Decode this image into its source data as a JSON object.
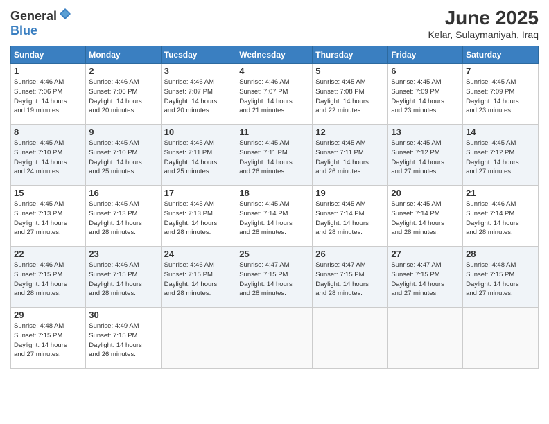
{
  "logo": {
    "general": "General",
    "blue": "Blue"
  },
  "header": {
    "title": "June 2025",
    "subtitle": "Kelar, Sulaymaniyah, Iraq"
  },
  "weekdays": [
    "Sunday",
    "Monday",
    "Tuesday",
    "Wednesday",
    "Thursday",
    "Friday",
    "Saturday"
  ],
  "weeks": [
    [
      {
        "day": "1",
        "info": "Sunrise: 4:46 AM\nSunset: 7:06 PM\nDaylight: 14 hours\nand 19 minutes."
      },
      {
        "day": "2",
        "info": "Sunrise: 4:46 AM\nSunset: 7:06 PM\nDaylight: 14 hours\nand 20 minutes."
      },
      {
        "day": "3",
        "info": "Sunrise: 4:46 AM\nSunset: 7:07 PM\nDaylight: 14 hours\nand 20 minutes."
      },
      {
        "day": "4",
        "info": "Sunrise: 4:46 AM\nSunset: 7:07 PM\nDaylight: 14 hours\nand 21 minutes."
      },
      {
        "day": "5",
        "info": "Sunrise: 4:45 AM\nSunset: 7:08 PM\nDaylight: 14 hours\nand 22 minutes."
      },
      {
        "day": "6",
        "info": "Sunrise: 4:45 AM\nSunset: 7:09 PM\nDaylight: 14 hours\nand 23 minutes."
      },
      {
        "day": "7",
        "info": "Sunrise: 4:45 AM\nSunset: 7:09 PM\nDaylight: 14 hours\nand 23 minutes."
      }
    ],
    [
      {
        "day": "8",
        "info": "Sunrise: 4:45 AM\nSunset: 7:10 PM\nDaylight: 14 hours\nand 24 minutes."
      },
      {
        "day": "9",
        "info": "Sunrise: 4:45 AM\nSunset: 7:10 PM\nDaylight: 14 hours\nand 25 minutes."
      },
      {
        "day": "10",
        "info": "Sunrise: 4:45 AM\nSunset: 7:11 PM\nDaylight: 14 hours\nand 25 minutes."
      },
      {
        "day": "11",
        "info": "Sunrise: 4:45 AM\nSunset: 7:11 PM\nDaylight: 14 hours\nand 26 minutes."
      },
      {
        "day": "12",
        "info": "Sunrise: 4:45 AM\nSunset: 7:11 PM\nDaylight: 14 hours\nand 26 minutes."
      },
      {
        "day": "13",
        "info": "Sunrise: 4:45 AM\nSunset: 7:12 PM\nDaylight: 14 hours\nand 27 minutes."
      },
      {
        "day": "14",
        "info": "Sunrise: 4:45 AM\nSunset: 7:12 PM\nDaylight: 14 hours\nand 27 minutes."
      }
    ],
    [
      {
        "day": "15",
        "info": "Sunrise: 4:45 AM\nSunset: 7:13 PM\nDaylight: 14 hours\nand 27 minutes."
      },
      {
        "day": "16",
        "info": "Sunrise: 4:45 AM\nSunset: 7:13 PM\nDaylight: 14 hours\nand 28 minutes."
      },
      {
        "day": "17",
        "info": "Sunrise: 4:45 AM\nSunset: 7:13 PM\nDaylight: 14 hours\nand 28 minutes."
      },
      {
        "day": "18",
        "info": "Sunrise: 4:45 AM\nSunset: 7:14 PM\nDaylight: 14 hours\nand 28 minutes."
      },
      {
        "day": "19",
        "info": "Sunrise: 4:45 AM\nSunset: 7:14 PM\nDaylight: 14 hours\nand 28 minutes."
      },
      {
        "day": "20",
        "info": "Sunrise: 4:45 AM\nSunset: 7:14 PM\nDaylight: 14 hours\nand 28 minutes."
      },
      {
        "day": "21",
        "info": "Sunrise: 4:46 AM\nSunset: 7:14 PM\nDaylight: 14 hours\nand 28 minutes."
      }
    ],
    [
      {
        "day": "22",
        "info": "Sunrise: 4:46 AM\nSunset: 7:15 PM\nDaylight: 14 hours\nand 28 minutes."
      },
      {
        "day": "23",
        "info": "Sunrise: 4:46 AM\nSunset: 7:15 PM\nDaylight: 14 hours\nand 28 minutes."
      },
      {
        "day": "24",
        "info": "Sunrise: 4:46 AM\nSunset: 7:15 PM\nDaylight: 14 hours\nand 28 minutes."
      },
      {
        "day": "25",
        "info": "Sunrise: 4:47 AM\nSunset: 7:15 PM\nDaylight: 14 hours\nand 28 minutes."
      },
      {
        "day": "26",
        "info": "Sunrise: 4:47 AM\nSunset: 7:15 PM\nDaylight: 14 hours\nand 28 minutes."
      },
      {
        "day": "27",
        "info": "Sunrise: 4:47 AM\nSunset: 7:15 PM\nDaylight: 14 hours\nand 27 minutes."
      },
      {
        "day": "28",
        "info": "Sunrise: 4:48 AM\nSunset: 7:15 PM\nDaylight: 14 hours\nand 27 minutes."
      }
    ],
    [
      {
        "day": "29",
        "info": "Sunrise: 4:48 AM\nSunset: 7:15 PM\nDaylight: 14 hours\nand 27 minutes."
      },
      {
        "day": "30",
        "info": "Sunrise: 4:49 AM\nSunset: 7:15 PM\nDaylight: 14 hours\nand 26 minutes."
      },
      {
        "day": "",
        "info": ""
      },
      {
        "day": "",
        "info": ""
      },
      {
        "day": "",
        "info": ""
      },
      {
        "day": "",
        "info": ""
      },
      {
        "day": "",
        "info": ""
      }
    ]
  ]
}
